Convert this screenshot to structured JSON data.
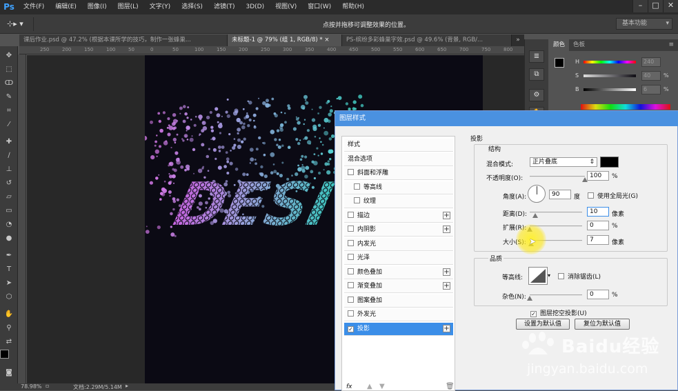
{
  "app": {
    "logo": "Ps"
  },
  "menu": [
    "文件(F)",
    "编辑(E)",
    "图像(I)",
    "图层(L)",
    "文字(Y)",
    "选择(S)",
    "滤镜(T)",
    "3D(D)",
    "视图(V)",
    "窗口(W)",
    "帮助(H)"
  ],
  "options": {
    "hint": "点按并拖移可调整效果的位置。",
    "workspace": "基本功能"
  },
  "tabs": [
    {
      "label": "课后作业.psd @ 47.2% (根据本课所学的技巧，制作一张蜂巢...",
      "active": false
    },
    {
      "label": "未标题-1 @ 79% (组 1, RGB/8) *",
      "active": true
    },
    {
      "label": "PS-缤纷多彩蜂巢字效.psd @ 49.6% (背景, RGB/...",
      "active": false
    }
  ],
  "ruler_top": [
    "250",
    "200",
    "150",
    "100",
    "50",
    "0",
    "50",
    "100",
    "150",
    "200",
    "250",
    "300",
    "350",
    "400",
    "450",
    "500",
    "550",
    "600",
    "650",
    "700",
    "750",
    "800",
    "850"
  ],
  "status": {
    "zoom": "78.98%",
    "doc": "文档:2.29M/5.14M"
  },
  "canvas_text": "DESI",
  "color_panel": {
    "tabs": [
      "颜色",
      "色板"
    ],
    "sliders": [
      {
        "label": "H",
        "value": "240",
        "unit": ""
      },
      {
        "label": "S",
        "value": "40",
        "unit": "%"
      },
      {
        "label": "B",
        "value": "6",
        "unit": "%"
      }
    ]
  },
  "dialog": {
    "title": "图层样式",
    "styles": [
      {
        "label": "样式",
        "checkbox": false,
        "plus": false,
        "indent": false,
        "selected": false,
        "checked": false
      },
      {
        "label": "混合选项",
        "checkbox": false,
        "plus": false,
        "indent": false,
        "selected": false,
        "checked": false
      },
      {
        "label": "斜面和浮雕",
        "checkbox": true,
        "plus": false,
        "indent": false,
        "selected": false,
        "checked": false
      },
      {
        "label": "等高线",
        "checkbox": true,
        "plus": false,
        "indent": true,
        "selected": false,
        "checked": false
      },
      {
        "label": "纹理",
        "checkbox": true,
        "plus": false,
        "indent": true,
        "selected": false,
        "checked": false
      },
      {
        "label": "描边",
        "checkbox": true,
        "plus": true,
        "indent": false,
        "selected": false,
        "checked": false
      },
      {
        "label": "内阴影",
        "checkbox": true,
        "plus": true,
        "indent": false,
        "selected": false,
        "checked": false
      },
      {
        "label": "内发光",
        "checkbox": true,
        "plus": false,
        "indent": false,
        "selected": false,
        "checked": false
      },
      {
        "label": "光泽",
        "checkbox": true,
        "plus": false,
        "indent": false,
        "selected": false,
        "checked": false
      },
      {
        "label": "颜色叠加",
        "checkbox": true,
        "plus": true,
        "indent": false,
        "selected": false,
        "checked": false
      },
      {
        "label": "渐变叠加",
        "checkbox": true,
        "plus": true,
        "indent": false,
        "selected": false,
        "checked": false
      },
      {
        "label": "图案叠加",
        "checkbox": true,
        "plus": false,
        "indent": false,
        "selected": false,
        "checked": false
      },
      {
        "label": "外发光",
        "checkbox": true,
        "plus": false,
        "indent": false,
        "selected": false,
        "checked": false
      },
      {
        "label": "投影",
        "checkbox": true,
        "plus": true,
        "indent": false,
        "selected": true,
        "checked": true
      }
    ],
    "footer": "fx",
    "section_title": "投影",
    "structure": {
      "title": "结构",
      "blend_label": "混合模式:",
      "blend_value": "正片叠底",
      "opacity_label": "不透明度(O):",
      "opacity_value": "100",
      "opacity_unit": "%",
      "angle_label": "角度(A):",
      "angle_value": "90",
      "angle_unit": "度",
      "global_light": "使用全局光(G)",
      "distance_label": "距离(D):",
      "distance_value": "10",
      "distance_unit": "像素",
      "spread_label": "扩展(R):",
      "spread_value": "0",
      "spread_unit": "%",
      "size_label": "大小(S):",
      "size_value": "7",
      "size_unit": "像素",
      "shadow_color": "#000000"
    },
    "quality": {
      "title": "品质",
      "contour_label": "等高线:",
      "antialias": "消除锯齿(L)",
      "noise_label": "杂色(N):",
      "noise_value": "0",
      "noise_unit": "%"
    },
    "knockout": "图层挖空投影(U)",
    "btn_default": "设置为默认值",
    "btn_reset": "复位为默认值"
  },
  "watermark": {
    "brand": "Baidu经验",
    "url": "jingyan.baidu.com"
  }
}
